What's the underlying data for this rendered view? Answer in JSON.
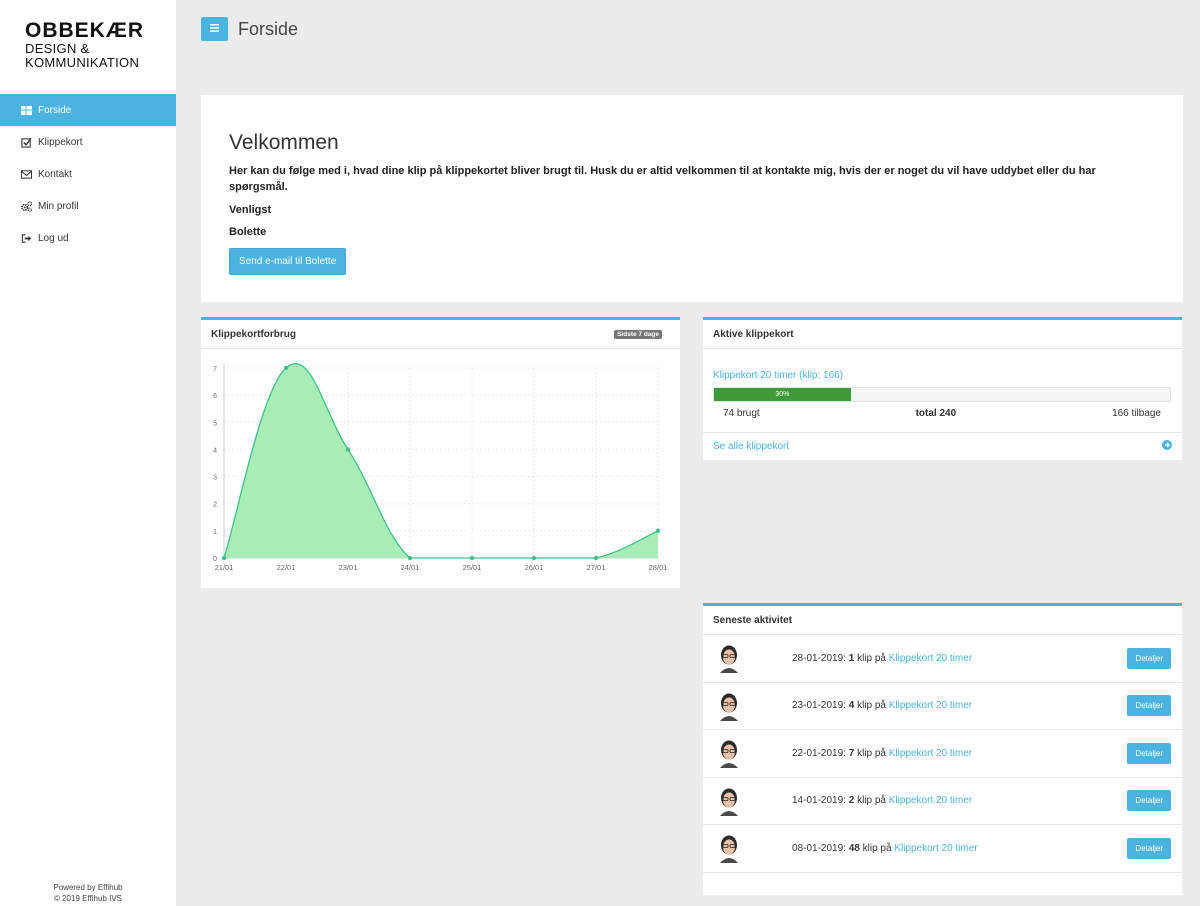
{
  "logo": {
    "main": "OBBEKÆR",
    "line1": "DESIGN &",
    "line2": "KOMMUNIKATION"
  },
  "sidebar": {
    "items": [
      {
        "label": "Forside",
        "icon": "dashboard-icon"
      },
      {
        "label": "Klippekort",
        "icon": "checkbox-icon"
      },
      {
        "label": "Kontakt",
        "icon": "envelope-icon"
      },
      {
        "label": "Min profil",
        "icon": "gears-icon"
      },
      {
        "label": "Log ud",
        "icon": "logout-icon"
      }
    ],
    "footer_line1": "Powered by Effihub",
    "footer_line2": "© 2019 Effihub IVS"
  },
  "header": {
    "title": "Forside"
  },
  "welcome": {
    "title": "Velkommen",
    "intro": "Her kan du følge med i, hvad dine klip på klippekortet bliver brugt til. Husk du er altid velkommen til at kontakte mig, hvis der er noget du vil have uddybet eller du har spørgsmål.",
    "greeting": "Venligst",
    "name": "Bolette",
    "button": "Send e-mail til Bolette"
  },
  "usage_panel": {
    "title": "Klippekortforbrug",
    "badge": "Sidste 7 dage"
  },
  "chart_data": {
    "type": "area",
    "x": [
      "21/01",
      "22/01",
      "23/01",
      "24/01",
      "25/01",
      "26/01",
      "27/01",
      "28/01"
    ],
    "values": [
      0,
      7,
      4,
      0,
      0,
      0,
      0,
      1
    ],
    "yticks": [
      0,
      1,
      2,
      3,
      4,
      5,
      6,
      7
    ],
    "ylim": [
      0,
      7
    ],
    "grid": true,
    "fill_color": "#a8edb6",
    "line_color": "#3fc08a"
  },
  "active_panel": {
    "title": "Aktive klippekort",
    "card_label": "Klippekort 20 timer (klip: 166)",
    "progress_label": "30%",
    "progress_value": 0.3,
    "used": "74 brugt",
    "total": "total 240",
    "remaining": "166 tilbage",
    "see_all": "Se alle klippekort"
  },
  "activity_panel": {
    "title": "Seneste aktivitet",
    "rows": [
      {
        "date": "28-01-2019:",
        "count": "1",
        "mid": "klip på",
        "link": "Klippekort 20 timer",
        "button": "Detaljer"
      },
      {
        "date": "23-01-2019:",
        "count": "4",
        "mid": "klip på",
        "link": "Klippekort 20 timer",
        "button": "Detaljer"
      },
      {
        "date": "22-01-2019:",
        "count": "7",
        "mid": "klip på",
        "link": "Klippekort 20 timer",
        "button": "Detaljer"
      },
      {
        "date": "14-01-2019:",
        "count": "2",
        "mid": "klip på",
        "link": "Klippekort 20 timer",
        "button": "Detaljer"
      },
      {
        "date": "08-01-2019:",
        "count": "48",
        "mid": "klip på",
        "link": "Klippekort 20 timer",
        "button": "Detaljer"
      }
    ]
  },
  "colors": {
    "accent": "#4ab3e0",
    "progress": "#3f9a3a"
  }
}
